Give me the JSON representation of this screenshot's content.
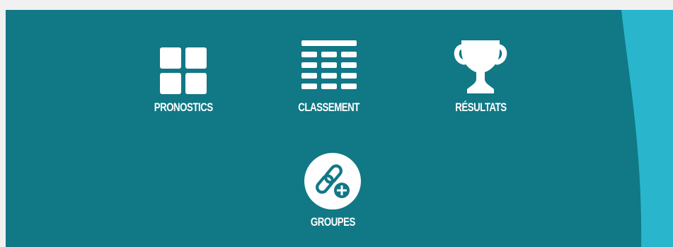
{
  "colors": {
    "panel_bg": "#117886",
    "accent_wave": "#29b6cc",
    "page_bg": "#f1f1f2",
    "icon_fg": "#ffffff"
  },
  "nav": {
    "items": [
      {
        "label": "PRONOSTICS",
        "icon": "grid-icon"
      },
      {
        "label": "CLASSEMENT",
        "icon": "table-icon"
      },
      {
        "label": "RÉSULTATS",
        "icon": "trophy-icon"
      },
      {
        "label": "GROUPES",
        "icon": "link-add-icon"
      }
    ]
  }
}
